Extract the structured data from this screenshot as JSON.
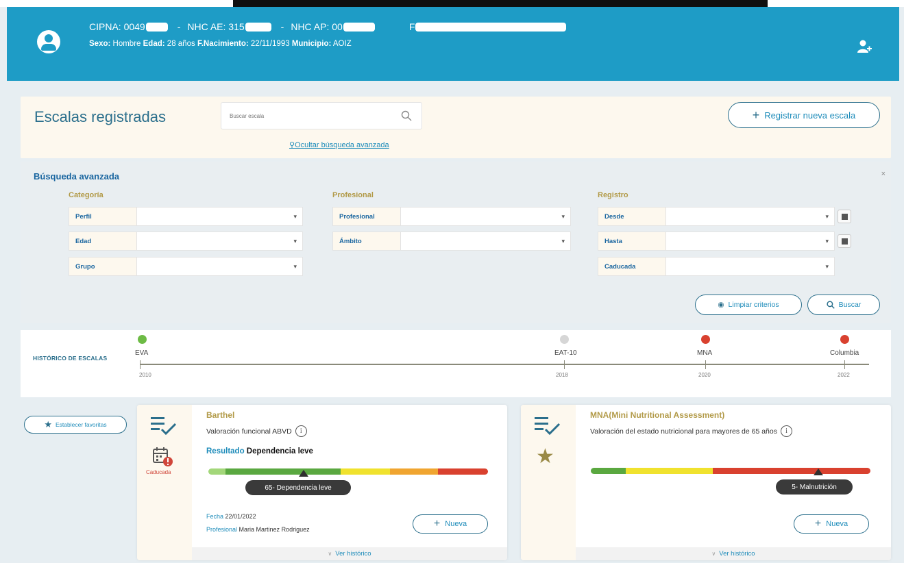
{
  "header": {
    "cipna_label": "CIPNA: 0049",
    "nhc_ae_label": "NHC AE: 315",
    "nhc_ap_label": "NHC AP: 00",
    "f_label": "F",
    "separator": "-",
    "sexo_label": "Sexo:",
    "sexo_value": "Hombre",
    "edad_label": "Edad:",
    "edad_value": "28 años",
    "fnac_label": "F.Nacimiento:",
    "fnac_value": "22/11/1993",
    "municipio_label": "Municipio:",
    "municipio_value": "AOIZ",
    "accent": "#1e9cc6"
  },
  "main": {
    "title": "Escalas registradas",
    "search_placeholder": "Buscar escala",
    "advanced_link": "Ocultar búsqueda avanzada",
    "register_button": "Registrar nueva escala"
  },
  "advanced": {
    "title": "Búsqueda avanzada",
    "close": "×",
    "categoria": {
      "title": "Categoría",
      "fields": [
        "Perfil",
        "Edad",
        "Grupo"
      ]
    },
    "profesional": {
      "title": "Profesional",
      "fields": [
        "Profesional",
        "Ámbito"
      ]
    },
    "registro": {
      "title": "Registro",
      "fields": [
        "Desde",
        "Hasta",
        "Caducada"
      ]
    },
    "clear_button": "Limpiar criterios",
    "search_button": "Buscar"
  },
  "timeline": {
    "label": "HISTÓRICO DE ESCALAS",
    "items": [
      {
        "name": "EVA",
        "year": "2010",
        "color": "#6dbb45"
      },
      {
        "name": "EAT-10",
        "year": "2018",
        "color": "#d6d6d6"
      },
      {
        "name": "MNA",
        "year": "2020",
        "color": "#d9412f"
      },
      {
        "name": "Columbia",
        "year": "2022",
        "color": "#d9412f"
      }
    ]
  },
  "favorites_button": "Establecer favoritas",
  "cards": [
    {
      "name": "Barthel",
      "description": "Valoración funcional ABVD",
      "result_label": "Resultado",
      "result_value": "Dependencia leve",
      "badge": "Caducada",
      "tooltip": "65- Dependencia leve",
      "fecha_label": "Fecha",
      "fecha_value": "22/01/2022",
      "profesional_label": "Profesional",
      "profesional_value": "Maria Martinez Rodriguez",
      "new_button": "Nueva",
      "footer": "Ver histórico"
    },
    {
      "name": "MNA(Mini Nutritional Assessment)",
      "description": "Valoración del estado nutricional para mayores de 65 años",
      "tooltip": "5- Malnutrición",
      "new_button": "Nueva",
      "footer": "Ver histórico"
    }
  ]
}
